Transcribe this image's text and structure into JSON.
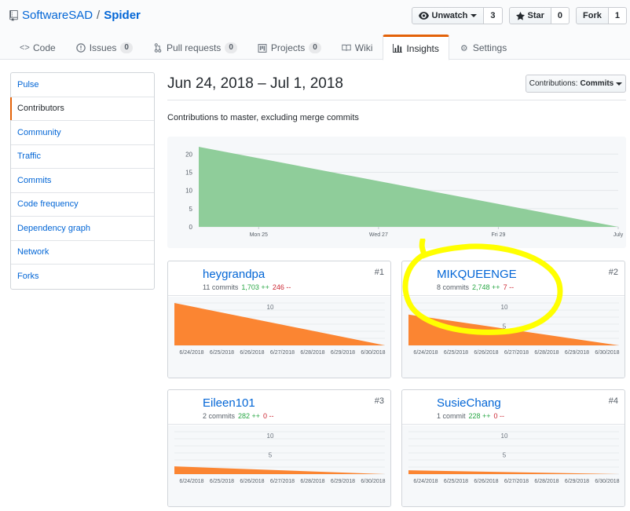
{
  "repo": {
    "owner": "SoftwareSAD",
    "separator": "/",
    "name": "Spider"
  },
  "actions": {
    "watch": {
      "label": "Unwatch",
      "count": "3"
    },
    "star": {
      "label": "Star",
      "count": "0"
    },
    "fork": {
      "label": "Fork",
      "count": "1"
    }
  },
  "nav": {
    "code": "Code",
    "issues": {
      "label": "Issues",
      "count": "0"
    },
    "pulls": {
      "label": "Pull requests",
      "count": "0"
    },
    "projects": {
      "label": "Projects",
      "count": "0"
    },
    "wiki": "Wiki",
    "insights": "Insights",
    "settings": "Settings"
  },
  "menu": [
    "Pulse",
    "Contributors",
    "Community",
    "Traffic",
    "Commits",
    "Code frequency",
    "Dependency graph",
    "Network",
    "Forks"
  ],
  "main": {
    "date_range": "Jun 24, 2018 – Jul 1, 2018",
    "dropdown_prefix": "Contributions:",
    "dropdown_value": "Commits",
    "subtitle": "Contributions to master, excluding merge commits"
  },
  "colors": {
    "accent": "#e36209",
    "link": "#0366d6",
    "area_main": "#8fcd9a",
    "area_user": "#fb8532",
    "highlight": "#ffff00",
    "additions": "#28a745",
    "deletions": "#cb2431"
  },
  "chart_data": [
    {
      "type": "area",
      "x": [
        "2018-06-24",
        "2018-07-01"
      ],
      "y": [
        22,
        0
      ],
      "tick_labels_x": [
        "Mon 25",
        "Wed 27",
        "Fri 29",
        "July"
      ],
      "yticks": [
        0,
        5,
        10,
        15,
        20
      ],
      "ylim": [
        0,
        22
      ],
      "grid": true
    },
    {
      "type": "area",
      "x": [
        "2018-06-24",
        "2018-07-01"
      ],
      "y": [
        11,
        0
      ],
      "yticks": [
        10
      ],
      "ylim": [
        0,
        11
      ],
      "tick_labels_x": [
        "6/24/2018",
        "6/25/2018",
        "6/26/2018",
        "6/27/2018",
        "6/28/2018",
        "6/29/2018",
        "6/30/2018"
      ]
    },
    {
      "type": "area",
      "x": [
        "2018-06-24",
        "2018-07-01"
      ],
      "y": [
        8,
        0
      ],
      "yticks": [
        5,
        10
      ],
      "ylim": [
        0,
        11
      ],
      "tick_labels_x": [
        "6/24/2018",
        "6/25/2018",
        "6/26/2018",
        "6/27/2018",
        "6/28/2018",
        "6/29/2018",
        "6/30/2018"
      ]
    },
    {
      "type": "area",
      "x": [
        "2018-06-24",
        "2018-07-01"
      ],
      "y": [
        2,
        0
      ],
      "yticks": [
        5,
        10
      ],
      "ylim": [
        0,
        11
      ],
      "tick_labels_x": [
        "6/24/2018",
        "6/25/2018",
        "6/26/2018",
        "6/27/2018",
        "6/28/2018",
        "6/29/2018",
        "6/30/2018"
      ]
    },
    {
      "type": "area",
      "x": [
        "2018-06-24",
        "2018-07-01"
      ],
      "y": [
        1,
        0
      ],
      "yticks": [
        5,
        10
      ],
      "ylim": [
        0,
        11
      ],
      "tick_labels_x": [
        "6/24/2018",
        "6/25/2018",
        "6/26/2018",
        "6/27/2018",
        "6/28/2018",
        "6/29/2018",
        "6/30/2018"
      ]
    }
  ],
  "contributors": [
    {
      "name": "heygrandpa",
      "rank": "#1",
      "commits": "11 commits",
      "additions": "1,703 ++",
      "deletions": "246 --"
    },
    {
      "name": "MIKQUEENGE",
      "rank": "#2",
      "commits": "8 commits",
      "additions": "2,748 ++",
      "deletions": "7 --"
    },
    {
      "name": "Eileen101",
      "rank": "#3",
      "commits": "2 commits",
      "additions": "282 ++",
      "deletions": "0 --"
    },
    {
      "name": "SusieChang",
      "rank": "#4",
      "commits": "1 commit",
      "additions": "228 ++",
      "deletions": "0 --"
    }
  ]
}
